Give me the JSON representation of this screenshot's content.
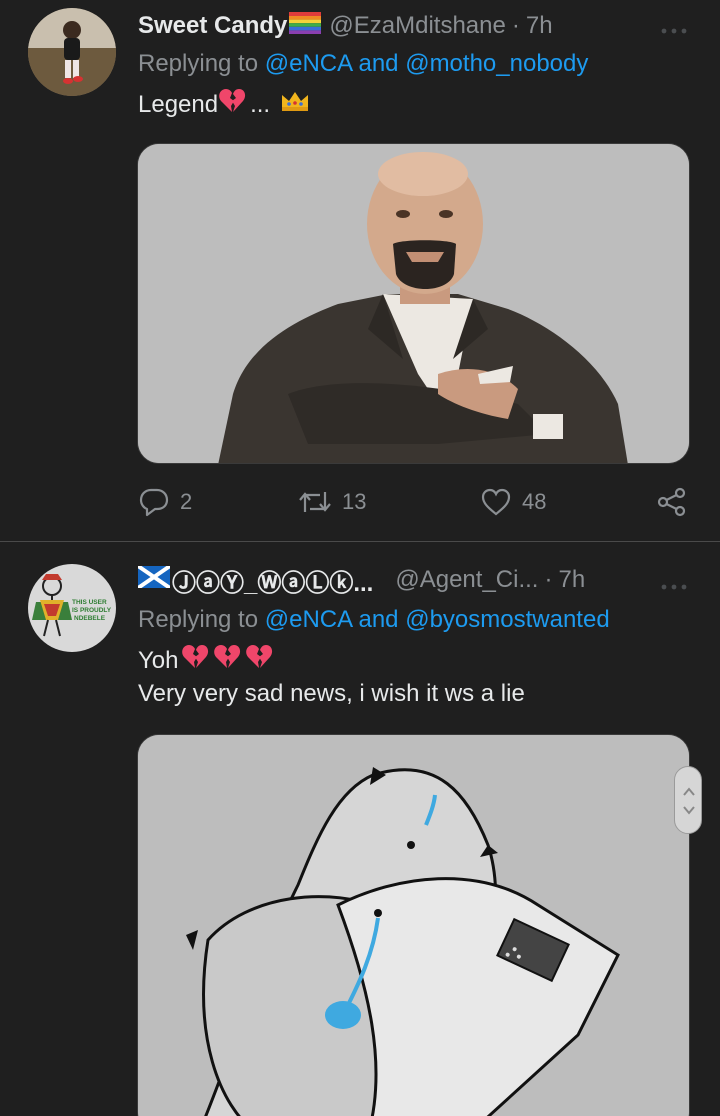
{
  "tweets": [
    {
      "display_name": "Sweet Candy",
      "handle": "@EzaMditshane",
      "separator": "·",
      "time": "7h",
      "replying_prefix": "Replying to",
      "mention1": "@eNCA",
      "and": "and",
      "mention2": "@motho_nobody",
      "text": "Legend",
      "text_suffix": "...",
      "actions": {
        "replies": "2",
        "retweets": "13",
        "likes": "48"
      }
    },
    {
      "display_name": "ⒿⓐⓎ_ⓌⓐⓁⓚ...",
      "handle": "@Agent_Ci...",
      "separator": "·",
      "time": "7h",
      "replying_prefix": "Replying to",
      "mention1": "@eNCA",
      "and": "and",
      "mention2": "@byosmostwanted",
      "text_line1": "Yoh",
      "text_line2": "Very very sad news, i wish it ws a lie",
      "avatar_text": "THIS USER IS PROUDLY NDEBELE"
    }
  ],
  "colors": {
    "background": "#1f1f1f",
    "text": "#e7e9ea",
    "secondary": "#8b8f93",
    "link": "#1d9bf0",
    "broken_heart": "#f0466a"
  },
  "icons": [
    "reply-icon",
    "retweet-icon",
    "like-icon",
    "share-icon",
    "more-icon",
    "broken-heart-icon",
    "crown-icon",
    "rainbow-flag-icon",
    "scotland-flag-icon"
  ]
}
